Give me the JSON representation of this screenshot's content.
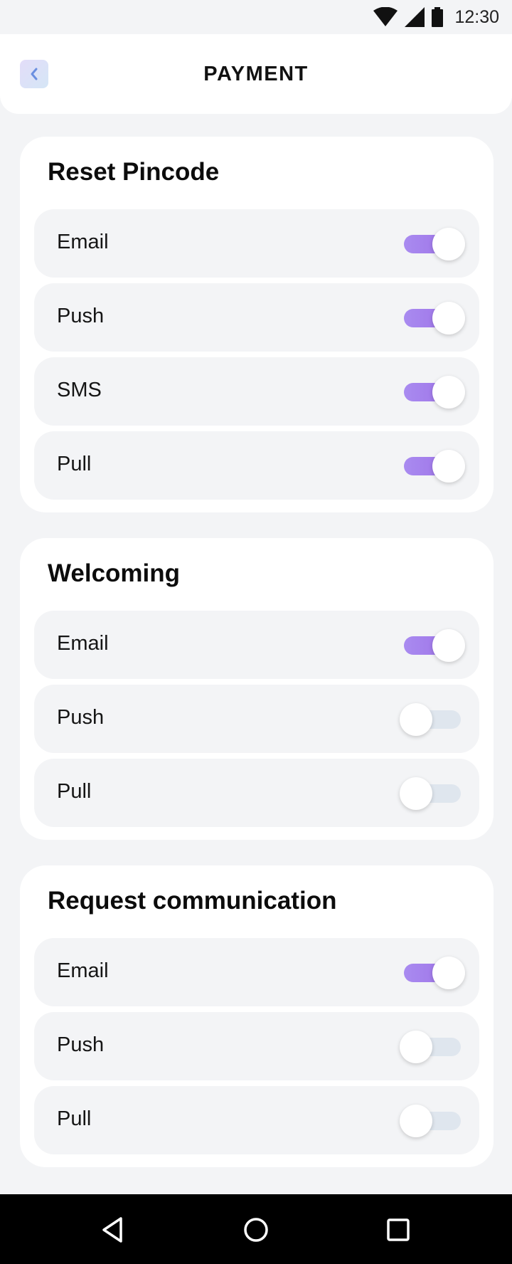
{
  "status_bar": {
    "time": "12:30",
    "icons": [
      "wifi-icon",
      "cellular-signal-icon",
      "battery-icon"
    ]
  },
  "header": {
    "title": "PAYMENT",
    "back_icon": "chevron-left-icon"
  },
  "sections": [
    {
      "title": "Reset Pincode",
      "items": [
        {
          "label": "Email",
          "enabled": true
        },
        {
          "label": "Push",
          "enabled": true
        },
        {
          "label": "SMS",
          "enabled": true
        },
        {
          "label": "Pull",
          "enabled": true
        }
      ]
    },
    {
      "title": "Welcoming",
      "items": [
        {
          "label": "Email",
          "enabled": true
        },
        {
          "label": "Push",
          "enabled": false
        },
        {
          "label": "Pull",
          "enabled": false
        }
      ]
    },
    {
      "title": "Request communication",
      "items": [
        {
          "label": "Email",
          "enabled": true
        },
        {
          "label": "Push",
          "enabled": false
        },
        {
          "label": "Pull",
          "enabled": false
        }
      ]
    }
  ],
  "nav_bar": {
    "icons": [
      "back-triangle-icon",
      "home-circle-icon",
      "recents-square-icon"
    ]
  },
  "colors": {
    "toggle_on_start": "#a98bf0",
    "toggle_on_end": "#9c6ee6",
    "toggle_off": "#dfe6ee",
    "back_button_tint": "#6b8fe0"
  }
}
